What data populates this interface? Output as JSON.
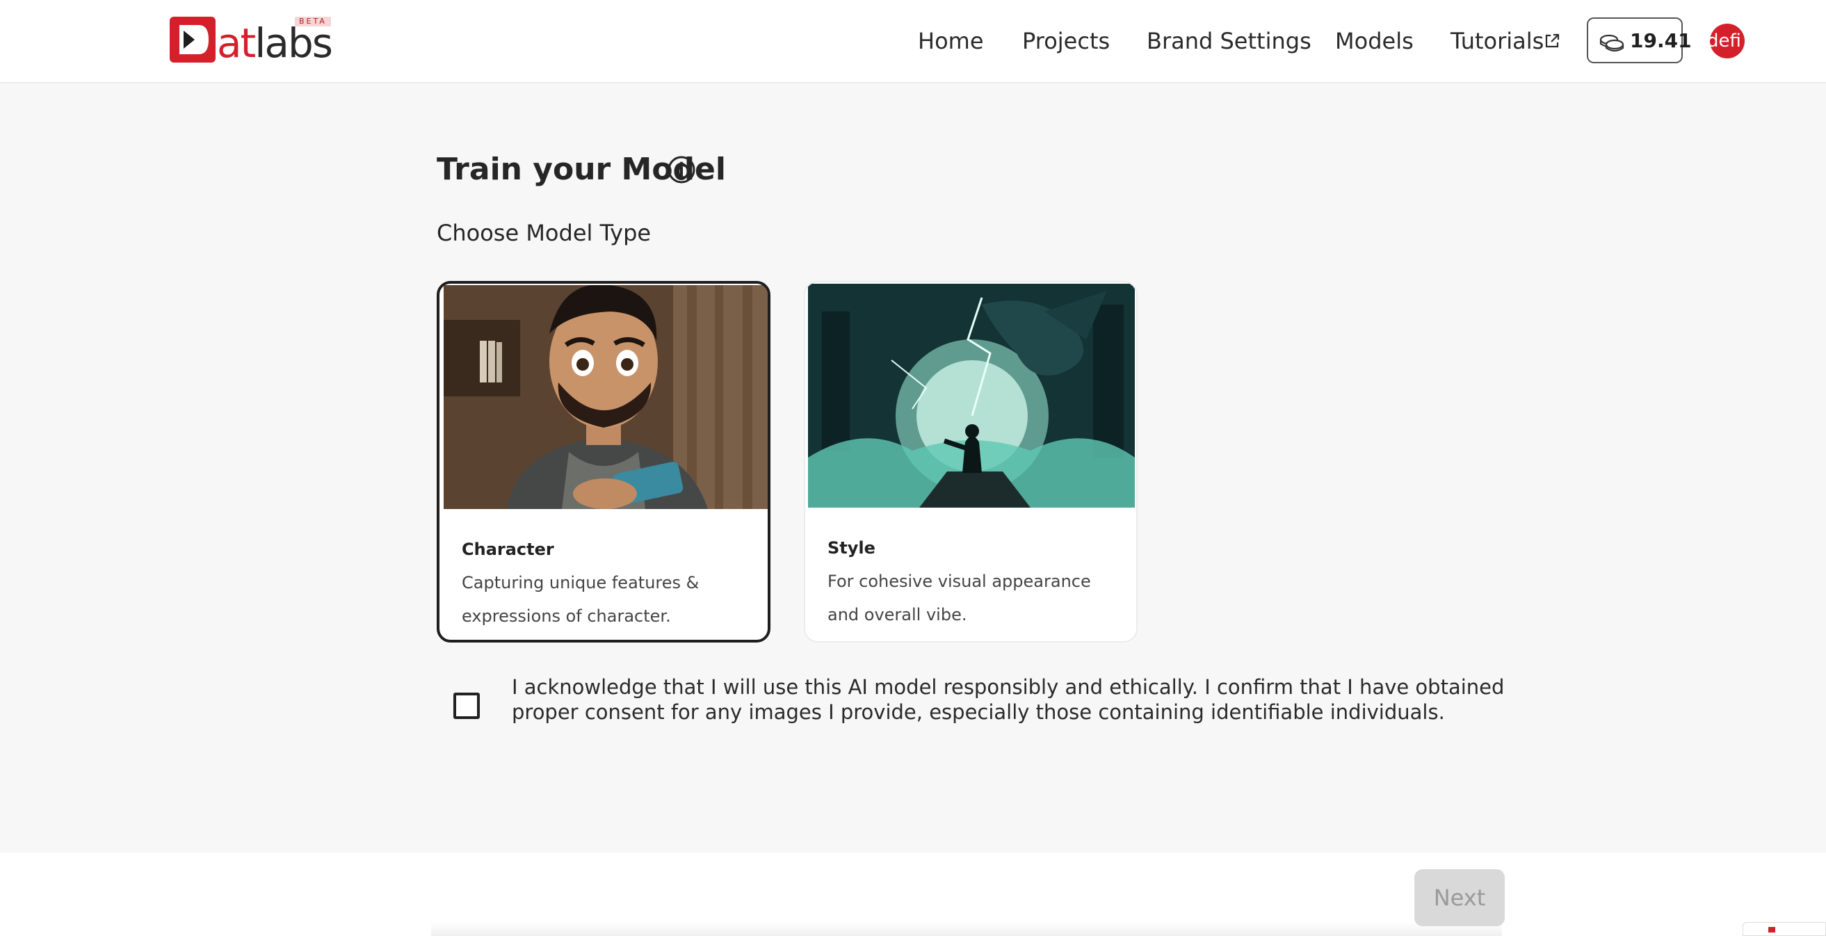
{
  "header": {
    "logo": {
      "prefix": "at",
      "suffix": "labs",
      "badge": "BETA"
    },
    "nav": {
      "home": "Home",
      "projects": "Projects",
      "brand_settings": "Brand Settings",
      "models": "Models",
      "tutorials": "Tutorials"
    },
    "credits": "19.41",
    "avatar_text": "defi"
  },
  "main": {
    "title": "Train your Model",
    "section_label": "Choose Model Type",
    "cards": [
      {
        "title": "Character",
        "description": "Capturing unique features & expressions of character.",
        "selected": true
      },
      {
        "title": "Style",
        "description": "For cohesive visual appearance and overall vibe.",
        "selected": false
      }
    ],
    "consent": {
      "checked": false,
      "text": "I acknowledge that I will use this AI model responsibly and ethically. I confirm that I have obtained proper consent for any images I provide, especially those containing identifiable individuals."
    }
  },
  "footer": {
    "next_label": "Next",
    "next_enabled": false
  },
  "colors": {
    "brand_red": "#d4202a",
    "page_bg": "#f7f7f7",
    "disabled_button": "#d9d9d9"
  }
}
